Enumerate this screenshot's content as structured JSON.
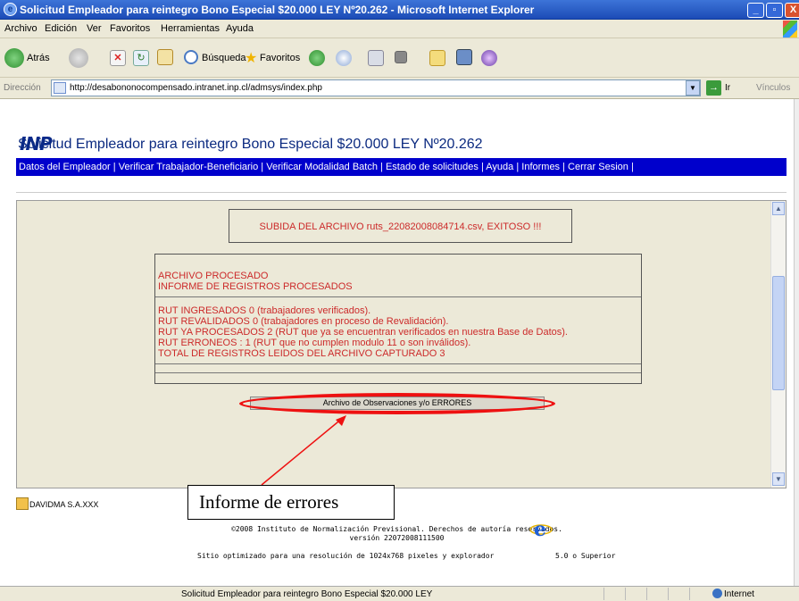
{
  "window": {
    "title": "Solicitud Empleador para reintegro Bono Especial $20.000 LEY Nº20.262 - Microsoft Internet Explorer",
    "controls": [
      "_",
      "▫",
      "X"
    ]
  },
  "menu": [
    "Archivo",
    "Edición",
    "Ver",
    "Favoritos",
    "Herramientas",
    "Ayuda"
  ],
  "toolbar": {
    "back_label": "Atrás",
    "search_label": "Búsqueda",
    "favorites_label": "Favoritos"
  },
  "address": {
    "label": "Dirección",
    "url": "http://desabononocompensado.intranet.inp.cl/admsys/index.php",
    "go_label": "Ir",
    "links_label": "Vínculos"
  },
  "page": {
    "logo": "INP",
    "title": "Solicitud Empleador para reintegro Bono Especial $20.000 LEY Nº20.262",
    "nav": [
      "Datos del Empleador",
      "Verificar Trabajador-Beneficiario",
      "Verificar Modalidad Batch",
      "Estado de solicitudes",
      "Ayuda",
      "Informes",
      "Cerrar Sesion"
    ],
    "nav_sep": " | ",
    "upload_message": "SUBIDA DEL ARCHIVO ruts_22082008084714.csv, EXITOSO !!!",
    "report": {
      "header": [
        "ARCHIVO PROCESADO",
        "INFORME DE REGISTROS PROCESADOS"
      ],
      "lines": [
        "RUT INGRESADOS 0 (trabajadores verificados).",
        "RUT REVALIDADOS 0 (trabajadores en proceso de Revalidación).",
        "RUT YA PROCESADOS 2 (RUT que ya se encuentran verificados en nuestra Base de Datos).",
        "RUT ERRONEOS : 1 (RUT que no cumplen modulo 11 o son inválidos).",
        "TOTAL DE REGISTROS LEIDOS DEL ARCHIVO CAPTURADO 3"
      ]
    },
    "errors_button": "Archivo de Observaciones y/o ERRORES",
    "callout": "Informe de errores",
    "company": "DAVIDMA S.A.XXX",
    "footer": {
      "copyright": "©2008 Instituto de Normalización Previsional. Derechos de autoría reservados.",
      "version": "versión 22072008111500",
      "optimized": "Sitio optimizado para una resolución de 1024x768 pixeles y explorador",
      "browser_version": "5.0 o Superior"
    }
  },
  "status": {
    "text": "Solicitud Empleador para reintegro Bono Especial $20.000 LEY",
    "zone": "Internet"
  },
  "colors": {
    "title_bar": "#1c4bb6",
    "nav_bar": "#0000cc",
    "report_text": "#cc2a2a",
    "highlight": "#e11111"
  }
}
